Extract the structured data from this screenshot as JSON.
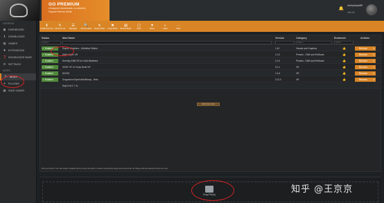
{
  "banner": {
    "title": "GO PREMIUM",
    "line1": "Uncapped downloads, no adverts",
    "line2": "Support Nexus Mods"
  },
  "user": {
    "name": "donkyinpar89",
    "level": "site ext",
    "bell": "🔔"
  },
  "sidebar": {
    "general_heading": "GENERAL",
    "mods_heading": "MODS",
    "general": [
      {
        "label": "DASHBOARD",
        "icon": "◼"
      },
      {
        "label": "DOWNLOADS",
        "icon": "⬇"
      },
      {
        "label": "GAMES",
        "icon": "▦"
      },
      {
        "label": "EXTENSIONS",
        "icon": "✚"
      },
      {
        "label": "KNOWLEDGE BASE",
        "icon": "❓"
      },
      {
        "label": "SETTINGS",
        "icon": "⚙"
      }
    ],
    "mods": [
      {
        "label": "MODS",
        "icon": "✎"
      },
      {
        "label": "PLUGINS",
        "icon": "✦"
      },
      {
        "label": "SAVE GAMES",
        "icon": "▣"
      }
    ]
  },
  "toolbar": [
    {
      "label": "Install From File",
      "icon": "⬇"
    },
    {
      "label": "Check for Up",
      "icon": "↻"
    },
    {
      "label": "Managed",
      "icon": "☰"
    },
    {
      "label": "Browse Mods",
      "icon": "🔍"
    },
    {
      "label": "Deploy Mods",
      "icon": "↯"
    },
    {
      "label": "Purge Mods",
      "icon": "✖"
    },
    {
      "label": "Browse Mods",
      "icon": "▤"
    },
    {
      "label": "Open",
      "icon": "▢"
    },
    {
      "label": "Filters",
      "icon": "▼"
    },
    {
      "label": "Show",
      "icon": "◐"
    },
    {
      "label": "More",
      "icon": "⋯"
    }
  ],
  "table": {
    "headers": {
      "status": "Status",
      "mod_name": "Mod Name",
      "version": "Version",
      "category": "Category",
      "endorsed": "Endorsed",
      "actions": "Actions"
    },
    "filters": {
      "status": "Select...",
      "mod_name": "",
      "version": "",
      "category": "Select...",
      "endorsed": "Select..."
    },
    "rows": [
      {
        "status": "Enabled",
        "name": "Skyrim Weathers - Definitive Edition",
        "version": "1.42",
        "category": "Visuals and Graphics",
        "action": "Remove"
      },
      {
        "status": "Enabled",
        "name": "ENB Helper VR",
        "version": "1.0.0",
        "category": "Presets - ENB and ReShade",
        "action": "Remove"
      },
      {
        "status": "Enabled",
        "name": "Serenity ENB VR for Vivid Weathers",
        "version": "1.0.0",
        "category": "Presets - ENB and ReShade",
        "action": "Remove"
      },
      {
        "status": "Enabled",
        "name": "SKSE VR 2.0 Scan Build VR",
        "version": "0.0.1",
        "category": "VR",
        "action": "Remove"
      },
      {
        "status": "Enabled",
        "name": "HIGGS",
        "version": "1.4.6",
        "category": "VR",
        "action": "Remove"
      },
      {
        "status": "Enabled",
        "name": "Dragonborn/SymbolMultibody - Beta",
        "version": "0.21.0",
        "category": "VR",
        "action": "Remove"
      },
      {
        "status": "",
        "name": "SkyUI v5.2 + 2c",
        "version": "",
        "category": "",
        "action": ""
      }
    ],
    "center_button": "Add more mods",
    "hint": "Did you know? You can select multiple items using ctrl+click or select everything using ctrl+a and then do things with all selected items at once."
  },
  "dropzone": {
    "label": "Drop File(s)"
  },
  "watermark": "知乎 @王京京"
}
